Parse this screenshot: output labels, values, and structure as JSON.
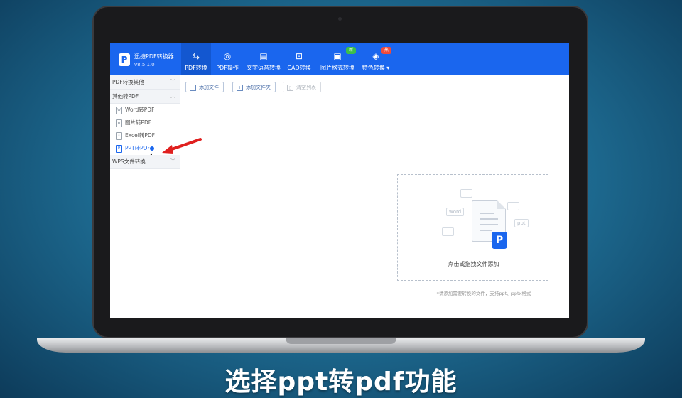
{
  "app": {
    "title": "迅捷PDF转换器",
    "version": "v8.5.1.0",
    "logo_letter": "P",
    "brand_color": "#1a66ee"
  },
  "nav": {
    "tabs": [
      {
        "label": "PDF转换",
        "icon": "convert-icon",
        "active": true
      },
      {
        "label": "PDF操作",
        "icon": "operation-icon"
      },
      {
        "label": "文字语音转换",
        "icon": "audio-icon"
      },
      {
        "label": "CAD转换",
        "icon": "cad-icon"
      },
      {
        "label": "图片格式转换",
        "icon": "image-icon",
        "badge": "新",
        "badge_color": "#3cbf4a"
      },
      {
        "label": "特色转换 ▾",
        "icon": "special-icon",
        "badge": "热",
        "badge_color": "#f04b3a"
      }
    ]
  },
  "sidebar": {
    "groups": [
      {
        "label": "PDF转换其他",
        "chevron": "﹀"
      },
      {
        "label": "其他转PDF",
        "chevron": "︿"
      },
      {
        "label": "WPS文件转换",
        "chevron": "﹀"
      }
    ],
    "items": [
      {
        "label": "Word转PDF"
      },
      {
        "label": "图片转PDF"
      },
      {
        "label": "Excel转PDF"
      },
      {
        "label": "PPT转PDF",
        "active": true
      }
    ]
  },
  "toolbar": {
    "add_file": "添加文件",
    "add_folder": "添加文件夹",
    "clear_list": "清空列表"
  },
  "dropzone": {
    "text": "点击或拖拽文件添加",
    "hint": "*请添加需要转换的文件，支持ppt、pptx格式",
    "tags": [
      "word",
      "ppt",
      "P"
    ]
  },
  "caption": "选择ppt转pdf功能"
}
